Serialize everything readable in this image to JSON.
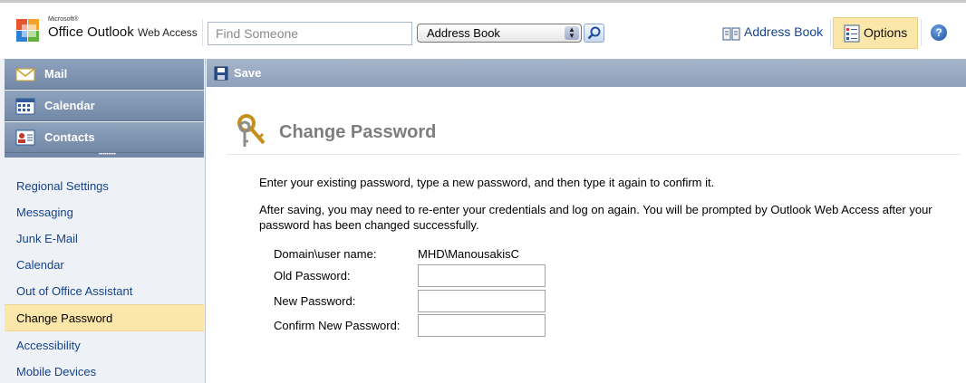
{
  "header": {
    "logo_small": "Microsoft®",
    "logo_product": "Office Outlook",
    "logo_suffix": "Web Access",
    "find_placeholder": "Find Someone",
    "address_book_select": "Address Book",
    "address_book_link": "Address Book",
    "options_label": "Options",
    "help_label": "?"
  },
  "nav": {
    "mail": "Mail",
    "calendar": "Calendar",
    "contacts": "Contacts",
    "options": [
      {
        "label": "Regional Settings"
      },
      {
        "label": "Messaging"
      },
      {
        "label": "Junk E-Mail"
      },
      {
        "label": "Calendar"
      },
      {
        "label": "Out of Office Assistant"
      },
      {
        "label": "Change Password"
      },
      {
        "label": "Accessibility"
      },
      {
        "label": "Mobile Devices"
      }
    ],
    "selected": "Change Password"
  },
  "toolbar": {
    "save_label": "Save"
  },
  "main": {
    "title": "Change Password",
    "intro": "Enter your existing password, type a new password, and then type it again to confirm it.",
    "note": "After saving, you may need to re-enter your credentials and log on again. You will be prompted by Outlook Web Access after your password has been changed successfully.",
    "domain_label": "Domain\\user name:",
    "domain_value": "MHD\\ManousakisC",
    "old_label": "Old Password:",
    "new_label": "New Password:",
    "confirm_label": "Confirm New Password:",
    "old_value": "",
    "new_value": "",
    "confirm_value": ""
  },
  "colors": {
    "nav_button": "#7f95b2",
    "toolbar": "#9aabc3",
    "selected": "#fbe7a9",
    "link": "#15428b",
    "title": "#7d7d7d"
  },
  "icons": [
    "outlook-logo-icon",
    "search-icon",
    "address-book-icon",
    "options-icon",
    "help-icon",
    "mail-icon",
    "calendar-icon",
    "contacts-icon",
    "save-icon",
    "keys-icon"
  ]
}
